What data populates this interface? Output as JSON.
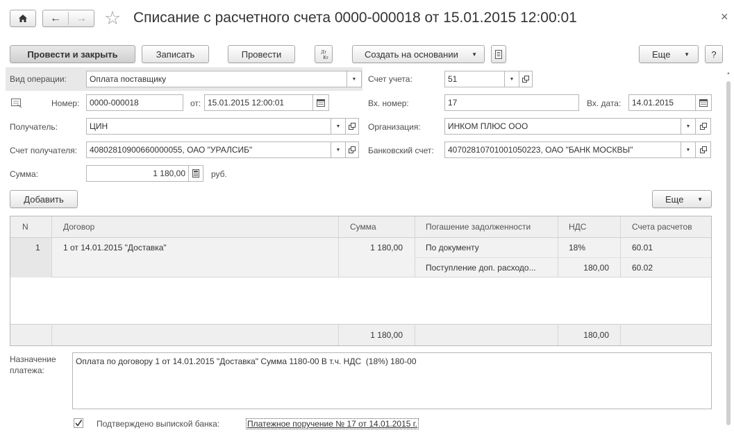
{
  "window": {
    "title": "Списание с расчетного счета 0000-000018 от 15.01.2015 12:00:01",
    "close_glyph": "×"
  },
  "nav": {
    "home_icon": "home-icon",
    "back_glyph": "←",
    "forward_glyph": "→",
    "favorite_glyph": "☆"
  },
  "toolbar": {
    "post_and_close": "Провести и закрыть",
    "save": "Записать",
    "post": "Провести",
    "dtkt_top": "Дт",
    "dtkt_bottom": "Кт",
    "create_based_on": "Создать на основании",
    "more": "Еще",
    "help": "?"
  },
  "form": {
    "operation_label": "Вид операции:",
    "operation_value": "Оплата поставщику",
    "account_label": "Счет учета:",
    "account_value": "51",
    "number_label": "Номер:",
    "number_value": "0000-000018",
    "date_label": "от:",
    "date_value": "15.01.2015 12:00:01",
    "in_number_label": "Вх. номер:",
    "in_number_value": "17",
    "in_date_label": "Вх. дата:",
    "in_date_value": "14.01.2015",
    "recipient_label": "Получатель:",
    "recipient_value": "ЦИН",
    "organization_label": "Организация:",
    "organization_value": "ИНКОМ ПЛЮС ООО",
    "recipient_account_label": "Счет получателя:",
    "recipient_account_value": "40802810900660000055, ОАО \"УРАЛСИБ\"",
    "bank_account_label": "Банковский счет:",
    "bank_account_value": "40702810701001050223, ОАО \"БАНК МОСКВЫ\"",
    "sum_label": "Сумма:",
    "sum_value": "1 180,00",
    "currency": "руб."
  },
  "table_toolbar": {
    "add": "Добавить",
    "more": "Еще"
  },
  "table": {
    "columns": [
      "N",
      "Договор",
      "Сумма",
      "Погашение задолженности",
      "НДС",
      "Счета расчетов"
    ],
    "row1": {
      "n": "1",
      "contract": "1 от 14.01.2015 \"Доставка\"",
      "sum": "1 180,00",
      "repayment": "По документу",
      "vat": "18%",
      "account": "60.01",
      "repayment2": "Поступление доп. расходо...",
      "vat2": "180,00",
      "account2": "60.02"
    },
    "footer": {
      "sum": "1 180,00",
      "vat": "180,00"
    }
  },
  "purpose": {
    "label_line1": "Назначение",
    "label_line2": "платежа:",
    "text": "Оплата по договору 1 от 14.01.2015 \"Доставка\" Сумма 1180-00 В т.ч. НДС  (18%) 180-00"
  },
  "footer": {
    "confirmed_label": "Подтверждено выпиской банка:",
    "confirmed_checked": true,
    "payment_link": "Платежное поручение № 17 от 14.01.2015 г."
  }
}
